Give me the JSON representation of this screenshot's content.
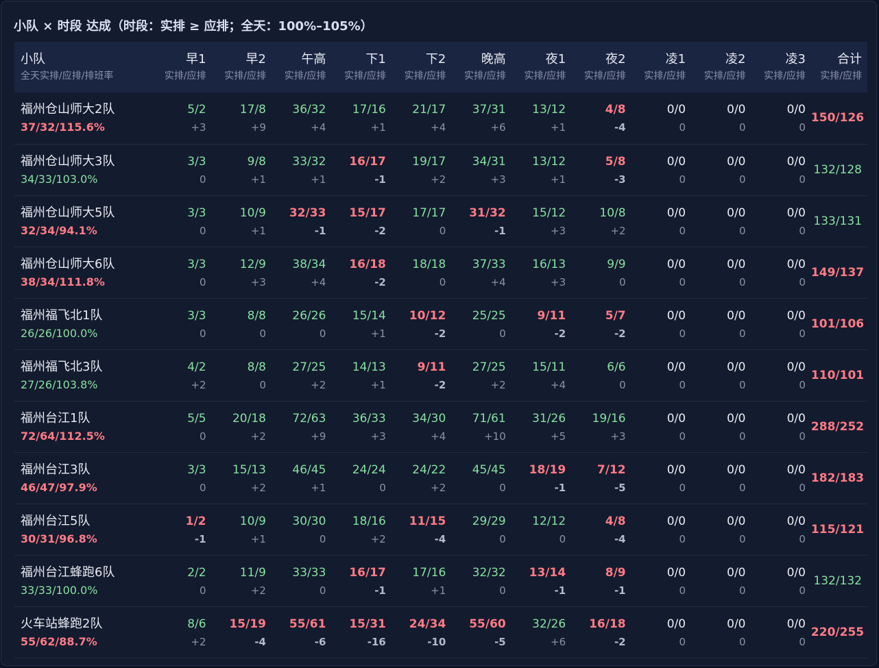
{
  "title": "小队 × 时段 达成（时段：实排 ≥ 应排；全天：100%–105%）",
  "header": {
    "team_label": "小队",
    "team_sub": "全天实排/应排/排班率",
    "segments": [
      "早1",
      "早2",
      "午高",
      "下1",
      "下2",
      "晚高",
      "夜1",
      "夜2",
      "凌1",
      "凌2",
      "凌3"
    ],
    "segment_sub": "实排/应排",
    "total_label": "合计",
    "total_sub": "实排/应排"
  },
  "colors": {
    "ok": "#86e0a0",
    "bad": "#ff7b86",
    "neutral": "#e8ebf2",
    "muted": "#8a93ab"
  },
  "rows": [
    {
      "name": "福州仓山师大2队",
      "summary": "37/32/115.6%",
      "summary_status": "bad",
      "cells": [
        [
          "5/2",
          "+3",
          "ok"
        ],
        [
          "17/8",
          "+9",
          "ok"
        ],
        [
          "36/32",
          "+4",
          "ok"
        ],
        [
          "17/16",
          "+1",
          "ok"
        ],
        [
          "21/17",
          "+4",
          "ok"
        ],
        [
          "37/31",
          "+6",
          "ok"
        ],
        [
          "13/12",
          "+1",
          "ok"
        ],
        [
          "4/8",
          "-4",
          "bad"
        ],
        [
          "0/0",
          "0",
          "neutral"
        ],
        [
          "0/0",
          "0",
          "neutral"
        ],
        [
          "0/0",
          "0",
          "neutral"
        ]
      ],
      "total": "150/126",
      "total_status": "bad"
    },
    {
      "name": "福州仓山师大3队",
      "summary": "34/33/103.0%",
      "summary_status": "ok",
      "cells": [
        [
          "3/3",
          "0",
          "ok"
        ],
        [
          "9/8",
          "+1",
          "ok"
        ],
        [
          "33/32",
          "+1",
          "ok"
        ],
        [
          "16/17",
          "-1",
          "bad"
        ],
        [
          "19/17",
          "+2",
          "ok"
        ],
        [
          "34/31",
          "+3",
          "ok"
        ],
        [
          "13/12",
          "+1",
          "ok"
        ],
        [
          "5/8",
          "-3",
          "bad"
        ],
        [
          "0/0",
          "0",
          "neutral"
        ],
        [
          "0/0",
          "0",
          "neutral"
        ],
        [
          "0/0",
          "0",
          "neutral"
        ]
      ],
      "total": "132/128",
      "total_status": "ok"
    },
    {
      "name": "福州仓山师大5队",
      "summary": "32/34/94.1%",
      "summary_status": "bad",
      "cells": [
        [
          "3/3",
          "0",
          "ok"
        ],
        [
          "10/9",
          "+1",
          "ok"
        ],
        [
          "32/33",
          "-1",
          "bad"
        ],
        [
          "15/17",
          "-2",
          "bad"
        ],
        [
          "17/17",
          "0",
          "ok"
        ],
        [
          "31/32",
          "-1",
          "bad"
        ],
        [
          "15/12",
          "+3",
          "ok"
        ],
        [
          "10/8",
          "+2",
          "ok"
        ],
        [
          "0/0",
          "0",
          "neutral"
        ],
        [
          "0/0",
          "0",
          "neutral"
        ],
        [
          "0/0",
          "0",
          "neutral"
        ]
      ],
      "total": "133/131",
      "total_status": "ok"
    },
    {
      "name": "福州仓山师大6队",
      "summary": "38/34/111.8%",
      "summary_status": "bad",
      "cells": [
        [
          "3/3",
          "0",
          "ok"
        ],
        [
          "12/9",
          "+3",
          "ok"
        ],
        [
          "38/34",
          "+4",
          "ok"
        ],
        [
          "16/18",
          "-2",
          "bad"
        ],
        [
          "18/18",
          "0",
          "ok"
        ],
        [
          "37/33",
          "+4",
          "ok"
        ],
        [
          "16/13",
          "+3",
          "ok"
        ],
        [
          "9/9",
          "0",
          "ok"
        ],
        [
          "0/0",
          "0",
          "neutral"
        ],
        [
          "0/0",
          "0",
          "neutral"
        ],
        [
          "0/0",
          "0",
          "neutral"
        ]
      ],
      "total": "149/137",
      "total_status": "bad"
    },
    {
      "name": "福州福飞北1队",
      "summary": "26/26/100.0%",
      "summary_status": "ok",
      "cells": [
        [
          "3/3",
          "0",
          "ok"
        ],
        [
          "8/8",
          "0",
          "ok"
        ],
        [
          "26/26",
          "0",
          "ok"
        ],
        [
          "15/14",
          "+1",
          "ok"
        ],
        [
          "10/12",
          "-2",
          "bad"
        ],
        [
          "25/25",
          "0",
          "ok"
        ],
        [
          "9/11",
          "-2",
          "bad"
        ],
        [
          "5/7",
          "-2",
          "bad"
        ],
        [
          "0/0",
          "0",
          "neutral"
        ],
        [
          "0/0",
          "0",
          "neutral"
        ],
        [
          "0/0",
          "0",
          "neutral"
        ]
      ],
      "total": "101/106",
      "total_status": "bad"
    },
    {
      "name": "福州福飞北3队",
      "summary": "27/26/103.8%",
      "summary_status": "ok",
      "cells": [
        [
          "4/2",
          "+2",
          "ok"
        ],
        [
          "8/8",
          "0",
          "ok"
        ],
        [
          "27/25",
          "+2",
          "ok"
        ],
        [
          "14/13",
          "+1",
          "ok"
        ],
        [
          "9/11",
          "-2",
          "bad"
        ],
        [
          "27/25",
          "+2",
          "ok"
        ],
        [
          "15/11",
          "+4",
          "ok"
        ],
        [
          "6/6",
          "0",
          "ok"
        ],
        [
          "0/0",
          "0",
          "neutral"
        ],
        [
          "0/0",
          "0",
          "neutral"
        ],
        [
          "0/0",
          "0",
          "neutral"
        ]
      ],
      "total": "110/101",
      "total_status": "bad"
    },
    {
      "name": "福州台江1队",
      "summary": "72/64/112.5%",
      "summary_status": "bad",
      "cells": [
        [
          "5/5",
          "0",
          "ok"
        ],
        [
          "20/18",
          "+2",
          "ok"
        ],
        [
          "72/63",
          "+9",
          "ok"
        ],
        [
          "36/33",
          "+3",
          "ok"
        ],
        [
          "34/30",
          "+4",
          "ok"
        ],
        [
          "71/61",
          "+10",
          "ok"
        ],
        [
          "31/26",
          "+5",
          "ok"
        ],
        [
          "19/16",
          "+3",
          "ok"
        ],
        [
          "0/0",
          "0",
          "neutral"
        ],
        [
          "0/0",
          "0",
          "neutral"
        ],
        [
          "0/0",
          "0",
          "neutral"
        ]
      ],
      "total": "288/252",
      "total_status": "bad"
    },
    {
      "name": "福州台江3队",
      "summary": "46/47/97.9%",
      "summary_status": "bad",
      "cells": [
        [
          "3/3",
          "0",
          "ok"
        ],
        [
          "15/13",
          "+2",
          "ok"
        ],
        [
          "46/45",
          "+1",
          "ok"
        ],
        [
          "24/24",
          "0",
          "ok"
        ],
        [
          "24/22",
          "+2",
          "ok"
        ],
        [
          "45/45",
          "0",
          "ok"
        ],
        [
          "18/19",
          "-1",
          "bad"
        ],
        [
          "7/12",
          "-5",
          "bad"
        ],
        [
          "0/0",
          "0",
          "neutral"
        ],
        [
          "0/0",
          "0",
          "neutral"
        ],
        [
          "0/0",
          "0",
          "neutral"
        ]
      ],
      "total": "182/183",
      "total_status": "bad"
    },
    {
      "name": "福州台江5队",
      "summary": "30/31/96.8%",
      "summary_status": "bad",
      "cells": [
        [
          "1/2",
          "-1",
          "bad"
        ],
        [
          "10/9",
          "+1",
          "ok"
        ],
        [
          "30/30",
          "0",
          "ok"
        ],
        [
          "18/16",
          "+2",
          "ok"
        ],
        [
          "11/15",
          "-4",
          "bad"
        ],
        [
          "29/29",
          "0",
          "ok"
        ],
        [
          "12/12",
          "0",
          "ok"
        ],
        [
          "4/8",
          "-4",
          "bad"
        ],
        [
          "0/0",
          "0",
          "neutral"
        ],
        [
          "0/0",
          "0",
          "neutral"
        ],
        [
          "0/0",
          "0",
          "neutral"
        ]
      ],
      "total": "115/121",
      "total_status": "bad"
    },
    {
      "name": "福州台江蜂跑6队",
      "summary": "33/33/100.0%",
      "summary_status": "ok",
      "cells": [
        [
          "2/2",
          "0",
          "ok"
        ],
        [
          "11/9",
          "+2",
          "ok"
        ],
        [
          "33/33",
          "0",
          "ok"
        ],
        [
          "16/17",
          "-1",
          "bad"
        ],
        [
          "17/16",
          "+1",
          "ok"
        ],
        [
          "32/32",
          "0",
          "ok"
        ],
        [
          "13/14",
          "-1",
          "bad"
        ],
        [
          "8/9",
          "-1",
          "bad"
        ],
        [
          "0/0",
          "0",
          "neutral"
        ],
        [
          "0/0",
          "0",
          "neutral"
        ],
        [
          "0/0",
          "0",
          "neutral"
        ]
      ],
      "total": "132/132",
      "total_status": "ok"
    },
    {
      "name": "火车站蜂跑2队",
      "summary": "55/62/88.7%",
      "summary_status": "bad",
      "cells": [
        [
          "8/6",
          "+2",
          "ok"
        ],
        [
          "15/19",
          "-4",
          "bad"
        ],
        [
          "55/61",
          "-6",
          "bad"
        ],
        [
          "15/31",
          "-16",
          "bad"
        ],
        [
          "24/34",
          "-10",
          "bad"
        ],
        [
          "55/60",
          "-5",
          "bad"
        ],
        [
          "32/26",
          "+6",
          "ok"
        ],
        [
          "16/18",
          "-2",
          "bad"
        ],
        [
          "0/0",
          "0",
          "neutral"
        ],
        [
          "0/0",
          "0",
          "neutral"
        ],
        [
          "0/0",
          "0",
          "neutral"
        ]
      ],
      "total": "220/255",
      "total_status": "bad"
    }
  ]
}
